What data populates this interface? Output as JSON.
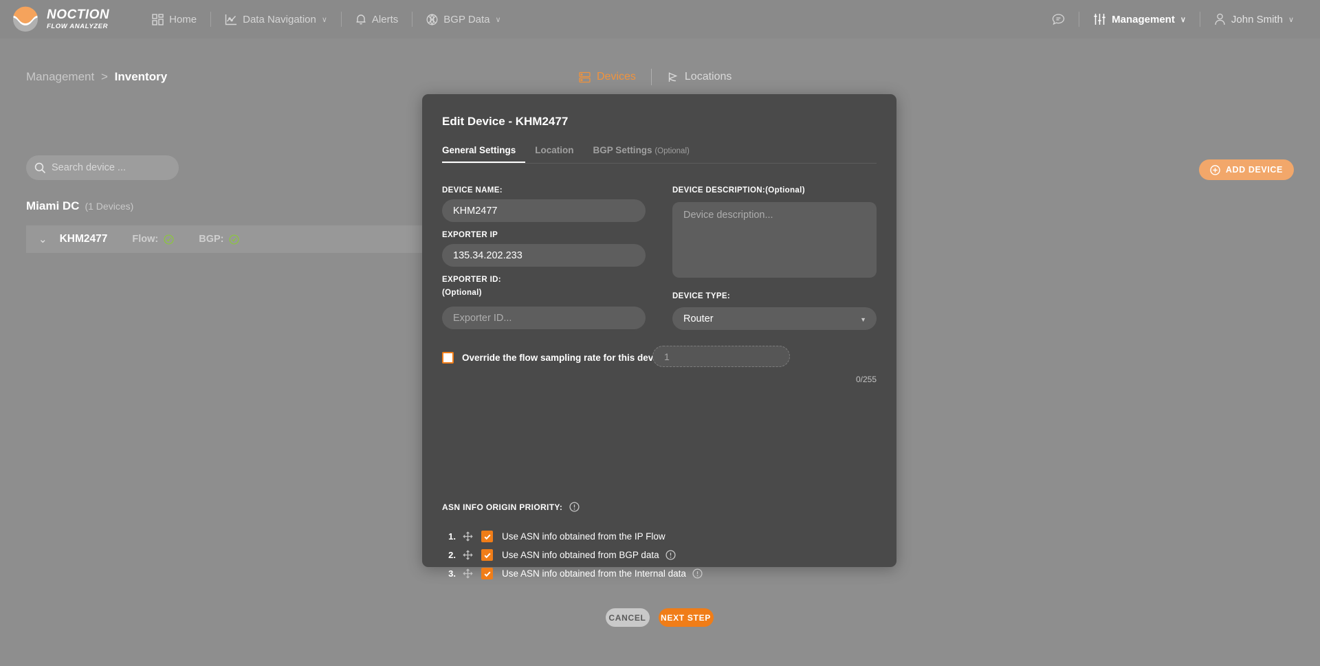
{
  "brand": {
    "name": "NOCTION",
    "subtitle": "FLOW ANALYZER",
    "logo_icon": "noction-wave-logo"
  },
  "topnav": {
    "items": [
      {
        "label": "Home",
        "icon": "grid-icon",
        "caret": ""
      },
      {
        "label": "Data Navigation",
        "icon": "line-chart-icon",
        "caret": "∨"
      },
      {
        "label": "Alerts",
        "icon": "bell-icon",
        "caret": ""
      },
      {
        "label": "BGP Data",
        "icon": "bgp-globe-icon",
        "caret": "∨"
      }
    ],
    "right": {
      "chat_icon": "chat-bubble-icon",
      "management_label": "Management",
      "management_icon": "sliders-icon",
      "management_caret": "∨",
      "user_label": "John Smith",
      "user_icon": "user-icon",
      "user_caret": "∨"
    }
  },
  "breadcrumb": {
    "parent": "Management",
    "separator": ">",
    "current": "Inventory"
  },
  "page_tabs": [
    {
      "label": "Devices",
      "icon": "server-rack-icon",
      "active": true
    },
    {
      "label": "Locations",
      "icon": "location-pin-icon",
      "active": false
    }
  ],
  "search": {
    "placeholder": "Search device ...",
    "value": "",
    "icon": "search-icon"
  },
  "group": {
    "name": "Miami DC",
    "count": "(1 Devices)"
  },
  "device_row": {
    "chevron": "⌄",
    "name": "KHM2477",
    "flow_label": "Flow:",
    "flow_status": "ok",
    "bgp_label": "BGP:",
    "bgp_status": "ok"
  },
  "toolbar": {
    "refresh_icon": "refresh-icon",
    "add_device_label": "ADD DEVICE",
    "add_device_icon": "plus-circle-icon"
  },
  "modal": {
    "title": "Edit Device - KHM2477",
    "tabs": [
      {
        "label": "General Settings",
        "optional": "",
        "active": true
      },
      {
        "label": "Location",
        "optional": "",
        "active": false
      },
      {
        "label": "BGP Settings",
        "optional": "(Optional)",
        "active": false
      }
    ],
    "fields": {
      "device_name": {
        "label": "DEVICE NAME:",
        "value": "KHM2477",
        "placeholder": ""
      },
      "exporter_ip": {
        "label": "EXPORTER IP",
        "value": "135.34.202.233",
        "placeholder": ""
      },
      "exporter_id": {
        "label": "EXPORTER ID:",
        "optional": "(Optional)",
        "value": "",
        "placeholder": "Exporter ID..."
      },
      "device_description": {
        "label": "DEVICE DESCRIPTION:",
        "optional": "(Optional)",
        "value": "",
        "placeholder": "Device description...",
        "charcount": "0/255"
      },
      "device_type": {
        "label": "DEVICE TYPE:",
        "value": "Router",
        "options": [
          "Router"
        ],
        "caret": "▼"
      }
    },
    "override": {
      "label": "Override the flow sampling rate for this device",
      "checked": false,
      "rate_value": "1",
      "rate_disabled": true
    },
    "asn_priority": {
      "label": "ASN INFO ORIGIN PRIORITY:",
      "info_icon": "info-circle-icon",
      "items": [
        {
          "num": "1.",
          "label": "Use ASN info obtained from the IP Flow",
          "checked": true,
          "has_info": false
        },
        {
          "num": "2.",
          "label": "Use ASN info obtained from BGP data",
          "checked": true,
          "has_info": true
        },
        {
          "num": "3.",
          "label": "Use ASN info obtained from the Internal data",
          "checked": true,
          "has_info": true
        }
      ]
    },
    "actions": {
      "cancel_label": "CANCEL",
      "next_label": "NEXT STEP"
    }
  },
  "colors": {
    "accent": "#f07d18",
    "accent_soft": "#f2a76a",
    "page_bg": "#8e8e8e",
    "modal_bg": "#4a4a4a",
    "input_bg": "#5e5e5e",
    "status_ok": "#8dc63f"
  }
}
